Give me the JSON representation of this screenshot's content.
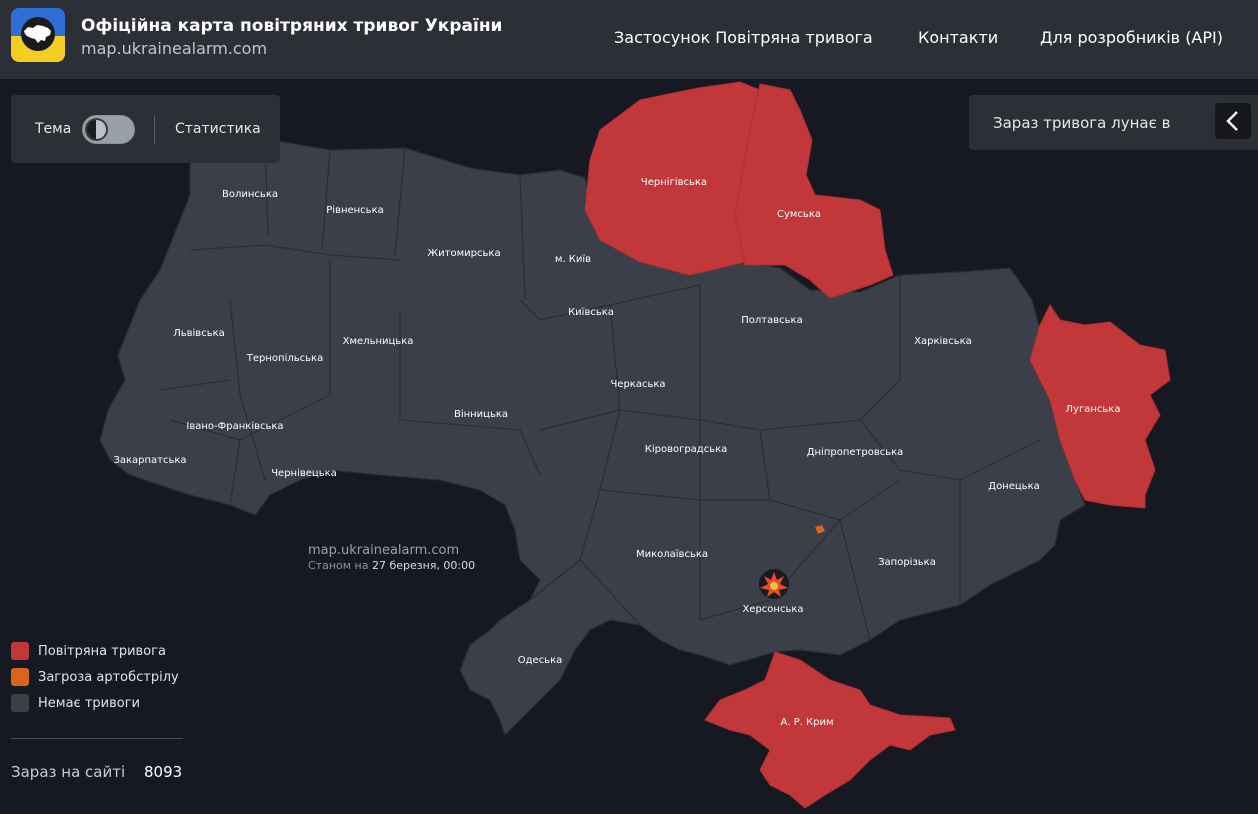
{
  "header": {
    "title": "Офіційна карта повітряних тривог України",
    "url": "map.ukrainealarm.com",
    "nav": [
      {
        "label": "Застосунок Повітряна тривога"
      },
      {
        "label": "Контакти"
      },
      {
        "label": "Для розробників (API)"
      }
    ]
  },
  "controls": {
    "theme_label": "Тема",
    "stats_label": "Статистика",
    "alert_panel_label": "Зараз тривога лунає в"
  },
  "colors": {
    "alarm": "#c2373a",
    "artillery": "#d8651c",
    "no_alarm": "#3b3f49",
    "background": "#161922",
    "header": "#2c2f36"
  },
  "map": {
    "watermark_url": "map.ukrainealarm.com",
    "status_prefix": "Станом на",
    "status_date": "27 березня, 00:00",
    "regions": [
      {
        "name": "Волинська",
        "status": "none"
      },
      {
        "name": "Рівненська",
        "status": "none"
      },
      {
        "name": "Житомирська",
        "status": "none"
      },
      {
        "name": "м. Київ",
        "status": "none"
      },
      {
        "name": "Чернігівська",
        "status": "alarm"
      },
      {
        "name": "Сумська",
        "status": "alarm"
      },
      {
        "name": "Львівська",
        "status": "none"
      },
      {
        "name": "Тернопільська",
        "status": "none"
      },
      {
        "name": "Хмельницька",
        "status": "none"
      },
      {
        "name": "Київська",
        "status": "none"
      },
      {
        "name": "Полтавська",
        "status": "none"
      },
      {
        "name": "Харківська",
        "status": "none"
      },
      {
        "name": "Черкаська",
        "status": "none"
      },
      {
        "name": "Луганська",
        "status": "alarm"
      },
      {
        "name": "Вінницька",
        "status": "none"
      },
      {
        "name": "Івано-Франківська",
        "status": "none"
      },
      {
        "name": "Кіровоградська",
        "status": "none"
      },
      {
        "name": "Дніпропетровська",
        "status": "none"
      },
      {
        "name": "Закарпатська",
        "status": "none"
      },
      {
        "name": "Чернівецька",
        "status": "none"
      },
      {
        "name": "Донецька",
        "status": "none"
      },
      {
        "name": "Миколаївська",
        "status": "none"
      },
      {
        "name": "Запорізька",
        "status": "none"
      },
      {
        "name": "Херсонська",
        "status": "none",
        "marker": "explosion-icon"
      },
      {
        "name": "Одеська",
        "status": "none"
      },
      {
        "name": "А. Р. Крим",
        "status": "alarm"
      }
    ]
  },
  "legend": [
    {
      "label": "Повітряна тривога",
      "color": "#c2373a"
    },
    {
      "label": "Загроза артобстрілу",
      "color": "#d8651c"
    },
    {
      "label": "Немає тривоги",
      "color": "#3b3f49"
    }
  ],
  "online": {
    "label": "Зараз на сайті",
    "count": "8093"
  }
}
